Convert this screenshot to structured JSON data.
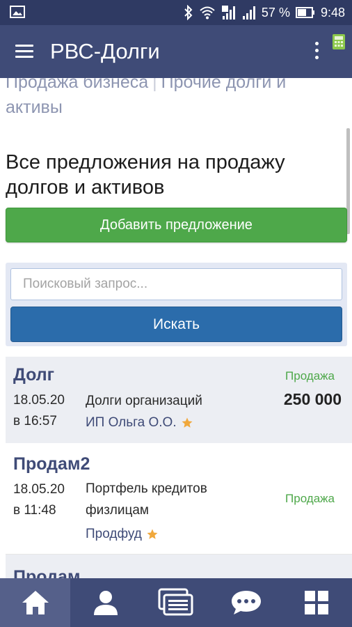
{
  "status_bar": {
    "battery_percent": "57 %",
    "time": "9:48",
    "icons": [
      "gallery-icon",
      "bluetooth-icon",
      "wifi-icon",
      "signal-icon",
      "signal-icon",
      "battery-icon"
    ]
  },
  "app_bar": {
    "title": "РВС-Долги",
    "icons": [
      "menu-icon",
      "more-vert-icon",
      "calculator-icon"
    ]
  },
  "category_links": {
    "items": [
      "Продажа бизнеса",
      "Прочие долги и активы"
    ],
    "separator": "|"
  },
  "page": {
    "heading": "Все предложения на продажу долгов и активов",
    "add_button_label": "Добавить предложение"
  },
  "search": {
    "placeholder": "Поисковый запрос...",
    "value": "",
    "button_label": "Искать"
  },
  "listings": [
    {
      "title": "Долг",
      "date": "18.05.20",
      "time": "в 16:57",
      "description": "Долги организаций",
      "author": "ИП Ольга О.О.",
      "author_starred": true,
      "type": "Продажа",
      "price": "250 000"
    },
    {
      "title": "Продам2",
      "date": "18.05.20",
      "time": "в 11:48",
      "description": "Портфель кредитов физлицам",
      "author": "Продфуд",
      "author_starred": true,
      "type": "Продажа",
      "price": ""
    },
    {
      "title": "Продам"
    }
  ],
  "bottom_nav": {
    "items": [
      {
        "icon": "home-icon",
        "active": true
      },
      {
        "icon": "profile-icon",
        "active": false
      },
      {
        "icon": "list-icon",
        "active": false
      },
      {
        "icon": "chat-icon",
        "active": false
      },
      {
        "icon": "apps-icon",
        "active": false
      }
    ]
  },
  "colors": {
    "status_bar": "#2f3a63",
    "app_bar": "#3f4b77",
    "add_button": "#4ea84a",
    "search_button": "#2b6cab",
    "sale_label": "#4ea84a",
    "star": "#f0a83c"
  }
}
